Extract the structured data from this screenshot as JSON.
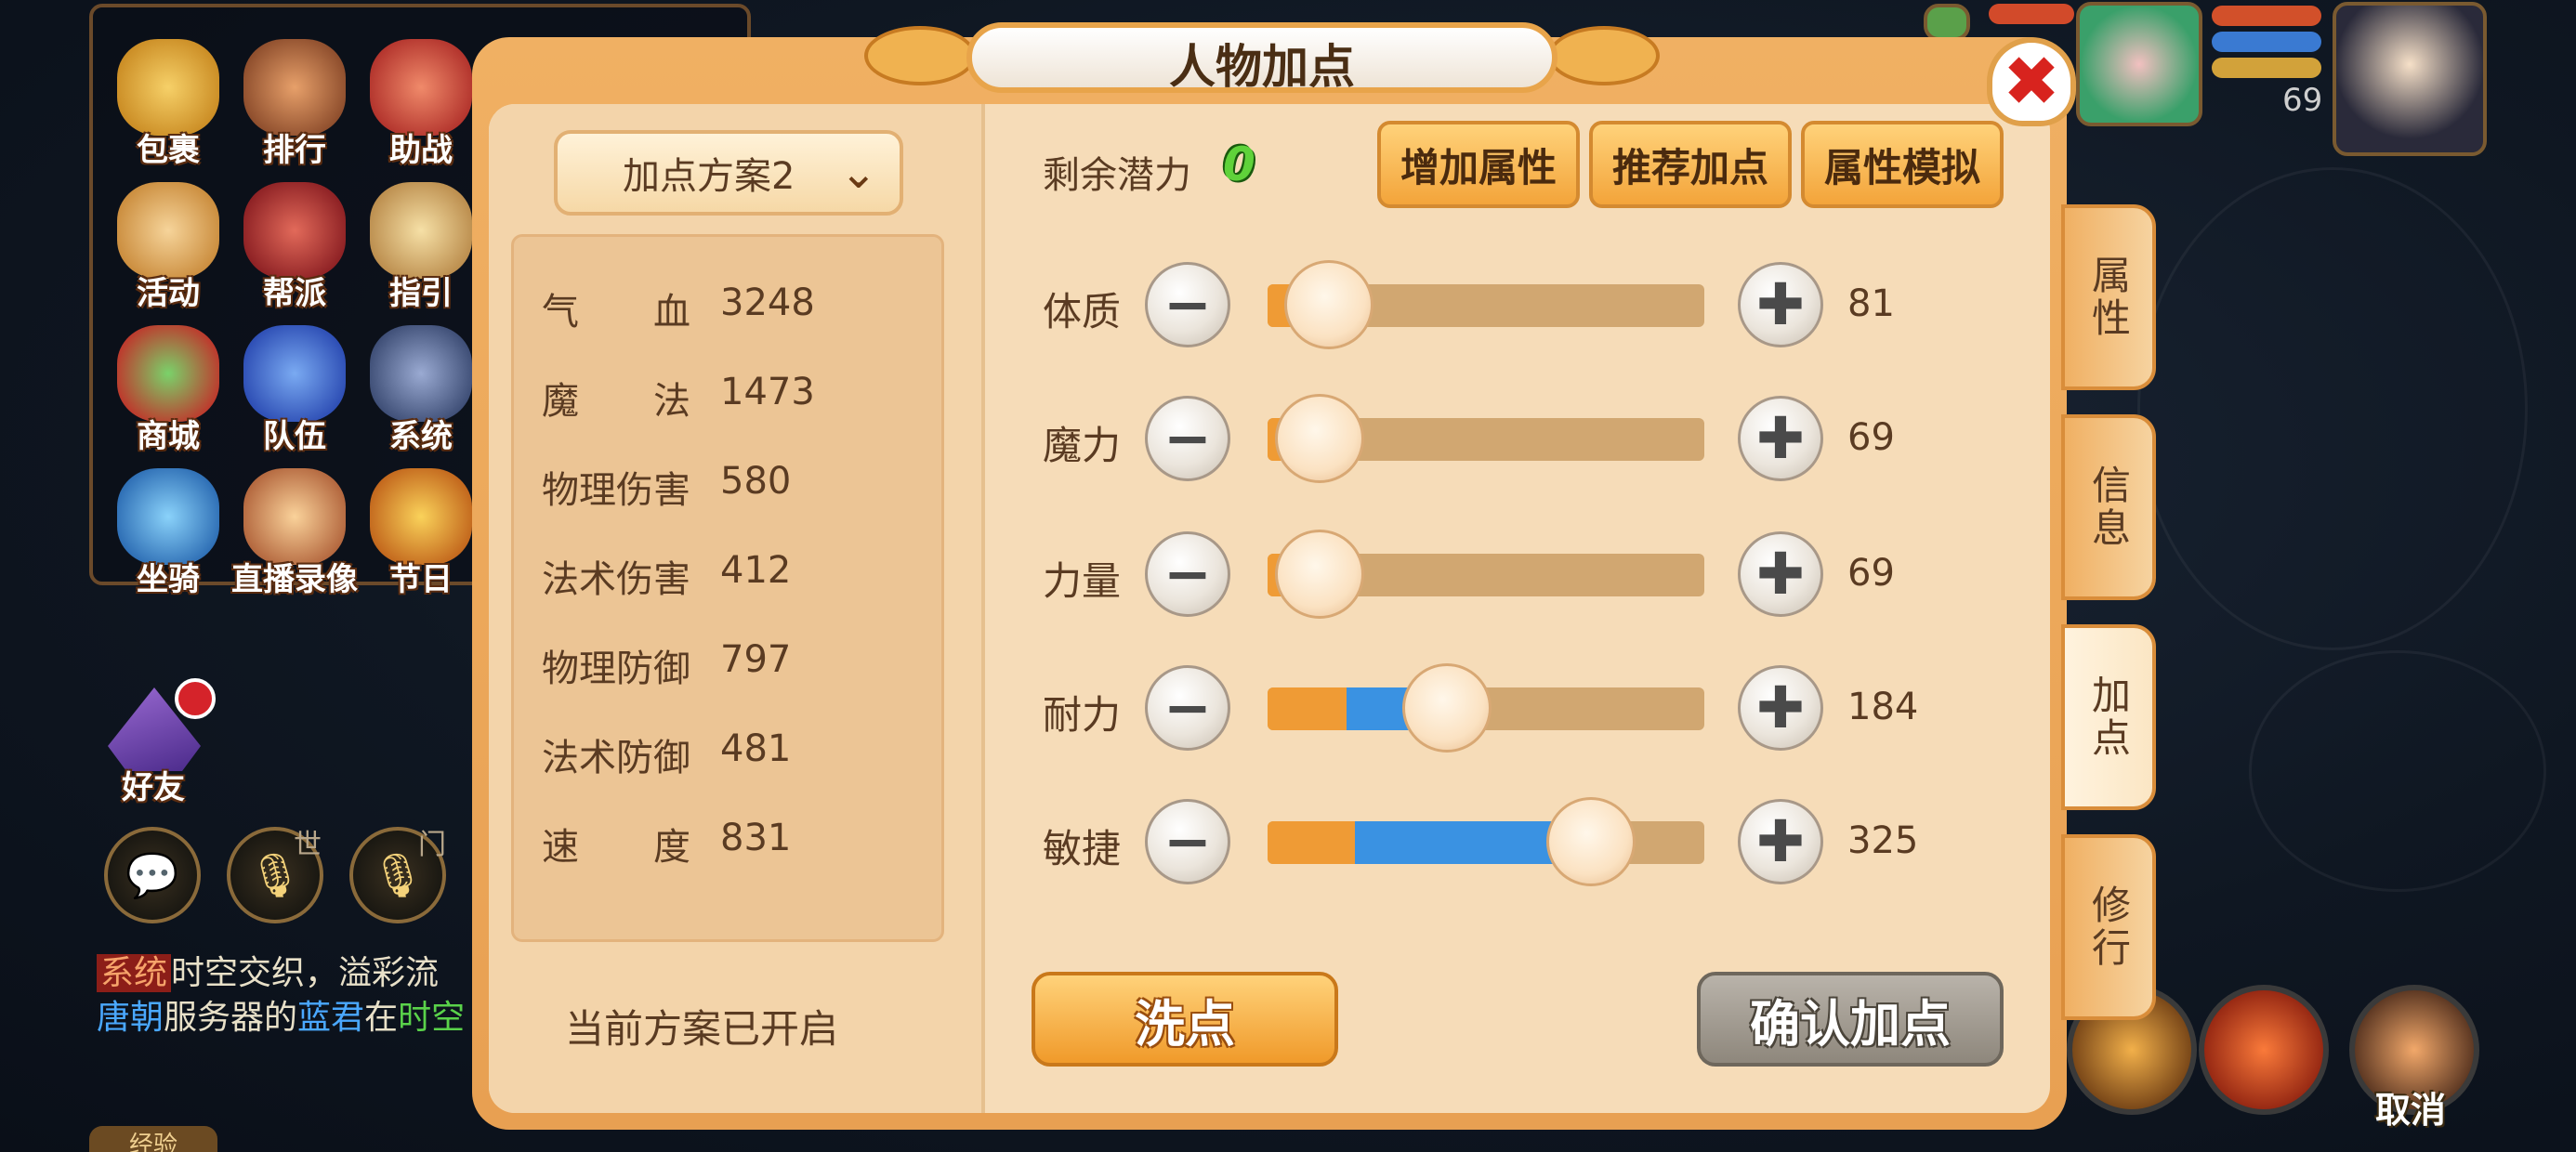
{
  "menu": {
    "items": [
      {
        "label": "包裹",
        "icon": "bag-icon",
        "color": "#e9b442"
      },
      {
        "label": "排行",
        "icon": "ranking-icon",
        "color": "#c97a3a"
      },
      {
        "label": "助战",
        "icon": "monkey-icon",
        "color": "#d2453a"
      },
      {
        "label": "活动",
        "icon": "horn-icon",
        "color": "#e8b05a"
      },
      {
        "label": "帮派",
        "icon": "flag-icon",
        "color": "#b0353a"
      },
      {
        "label": "指引",
        "icon": "book-icon",
        "color": "#e2c07a"
      },
      {
        "label": "商城",
        "icon": "gourd-icon",
        "color": "#3aa04a"
      },
      {
        "label": "队伍",
        "icon": "team-flag-icon",
        "color": "#3a6ad2"
      },
      {
        "label": "系统",
        "icon": "gear-icon",
        "color": "#6a7a9a"
      },
      {
        "label": "坐骑",
        "icon": "mount-icon",
        "color": "#4a9ae2"
      },
      {
        "label": "直播录像",
        "icon": "live-icon",
        "color": "#e2a65a"
      },
      {
        "label": "节日",
        "icon": "festival-icon",
        "color": "#e29a2a"
      }
    ]
  },
  "social": {
    "friend_label": "好友",
    "world_label": "世",
    "sect_label": "门"
  },
  "chat": {
    "tag": "系统",
    "line1": "时空交织，溢彩流",
    "line2_a": "唐朝",
    "line2_b": "服务器的",
    "line2_c": "蓝君",
    "line2_d": "在",
    "line2_e": "时空"
  },
  "exp_label": "经验",
  "hud": {
    "level": "69",
    "cancel_label": "取消"
  },
  "dialog": {
    "title": "人物加点",
    "close_symbol": "✖",
    "scheme": "加点方案2",
    "chevron": "⌄",
    "stats": [
      {
        "name": "气　　血",
        "value": "3248"
      },
      {
        "name": "魔　　法",
        "value": "1473"
      },
      {
        "name": "物理伤害",
        "value": "580"
      },
      {
        "name": "法术伤害",
        "value": "412"
      },
      {
        "name": "物理防御",
        "value": "797"
      },
      {
        "name": "法术防御",
        "value": "481"
      },
      {
        "name": "速　　度",
        "value": "831"
      }
    ],
    "plan_status": "当前方案已开启",
    "potential_label": "剩余潜力",
    "potential_value": "0",
    "buttons": {
      "add_attr": "增加属性",
      "recommend": "推荐加点",
      "simulate": "属性模拟",
      "wash": "洗点",
      "confirm": "确认加点"
    },
    "minus_symbol": "−",
    "plus_symbol": "✚",
    "attributes": [
      {
        "name": "体质",
        "value": "81",
        "base_fraction": 0.1,
        "added_fraction": 0.0,
        "level": 0.14
      },
      {
        "name": "魔力",
        "value": "69",
        "base_fraction": 0.1,
        "added_fraction": 0.0,
        "level": 0.12
      },
      {
        "name": "力量",
        "value": "69",
        "base_fraction": 0.1,
        "added_fraction": 0.0,
        "level": 0.12
      },
      {
        "name": "耐力",
        "value": "184",
        "base_fraction": 0.18,
        "added_fraction": 0.23,
        "level": 0.41
      },
      {
        "name": "敏捷",
        "value": "325",
        "base_fraction": 0.2,
        "added_fraction": 0.55,
        "level": 0.74
      }
    ],
    "side_tabs": [
      {
        "label": "属性",
        "active": false
      },
      {
        "label": "信息",
        "active": false
      },
      {
        "label": "加点",
        "active": true
      },
      {
        "label": "修行",
        "active": false
      }
    ]
  },
  "colors": {
    "panel": "#f6dcb8",
    "accent_orange": "#ef9b35",
    "accent_blue": "#3a92e2",
    "potential_green": "#5fd23a"
  }
}
